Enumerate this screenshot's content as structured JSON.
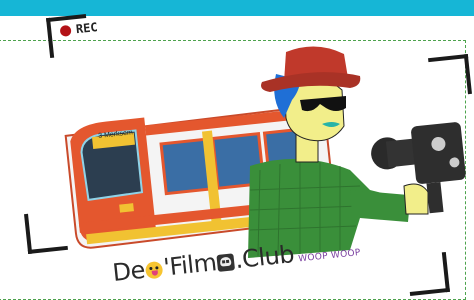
{
  "rec_label": "REC",
  "tram_sign": "3 Merksem",
  "logo": {
    "part1": "De",
    "part2": "'Film",
    "part3": ".Club",
    "tagline": "WOOP WOOP"
  },
  "colors": {
    "topbar": "#16b6d6",
    "rec_dot": "#b31217",
    "tram_red": "#e4572e",
    "hat": "#c0392b",
    "hair": "#1f6fd6",
    "skin": "#f2ee8a",
    "shirt": "#3a8f3a"
  }
}
